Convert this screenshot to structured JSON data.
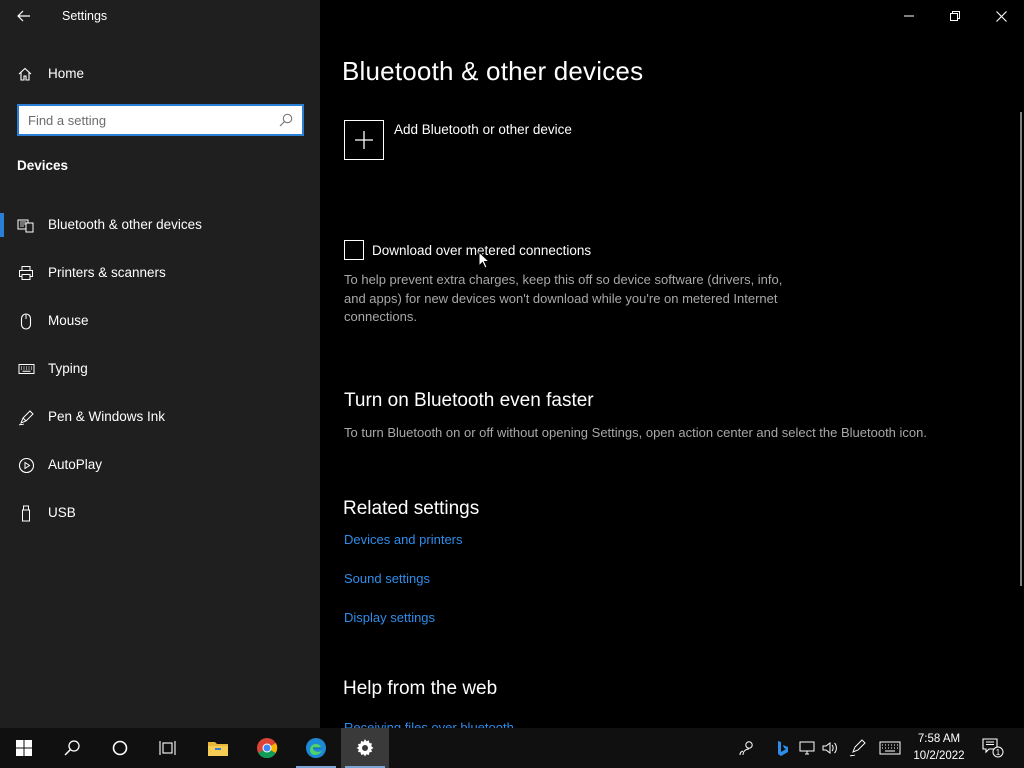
{
  "window": {
    "title": "Settings"
  },
  "sidebar": {
    "home_label": "Home",
    "search_placeholder": "Find a setting",
    "section_title": "Devices",
    "items": [
      {
        "label": "Bluetooth & other devices",
        "icon": "bluetooth-devices-icon",
        "active": true
      },
      {
        "label": "Printers & scanners",
        "icon": "printer-icon",
        "active": false
      },
      {
        "label": "Mouse",
        "icon": "mouse-icon",
        "active": false
      },
      {
        "label": "Typing",
        "icon": "keyboard-icon",
        "active": false
      },
      {
        "label": "Pen & Windows Ink",
        "icon": "pen-icon",
        "active": false
      },
      {
        "label": "AutoPlay",
        "icon": "autoplay-icon",
        "active": false
      },
      {
        "label": "USB",
        "icon": "usb-icon",
        "active": false
      }
    ]
  },
  "main": {
    "title": "Bluetooth & other devices",
    "add_device_label": "Add Bluetooth or other device",
    "metered_label": "Download over metered connections",
    "metered_checked": false,
    "metered_description": "To help prevent extra charges, keep this off so device software (drivers, info, and apps) for new devices won't download while you're on metered Internet connections.",
    "faster_heading": "Turn on Bluetooth even faster",
    "faster_description": "To turn Bluetooth on or off without opening Settings, open action center and select the Bluetooth icon.",
    "related_heading": "Related settings",
    "related_links": [
      "Devices and printers",
      "Sound settings",
      "Display settings"
    ],
    "help_heading": "Help from the web",
    "help_links": [
      "Receiving files over bluetooth"
    ]
  },
  "taskbar": {
    "time": "7:58 AM",
    "date": "10/2/2022",
    "notification_count": "1"
  },
  "colors": {
    "accent": "#2a7fd4",
    "link": "#2f8dea",
    "sidebar_bg": "#1f1f1f",
    "main_bg": "#000000",
    "description_text": "#a8a8a8"
  }
}
